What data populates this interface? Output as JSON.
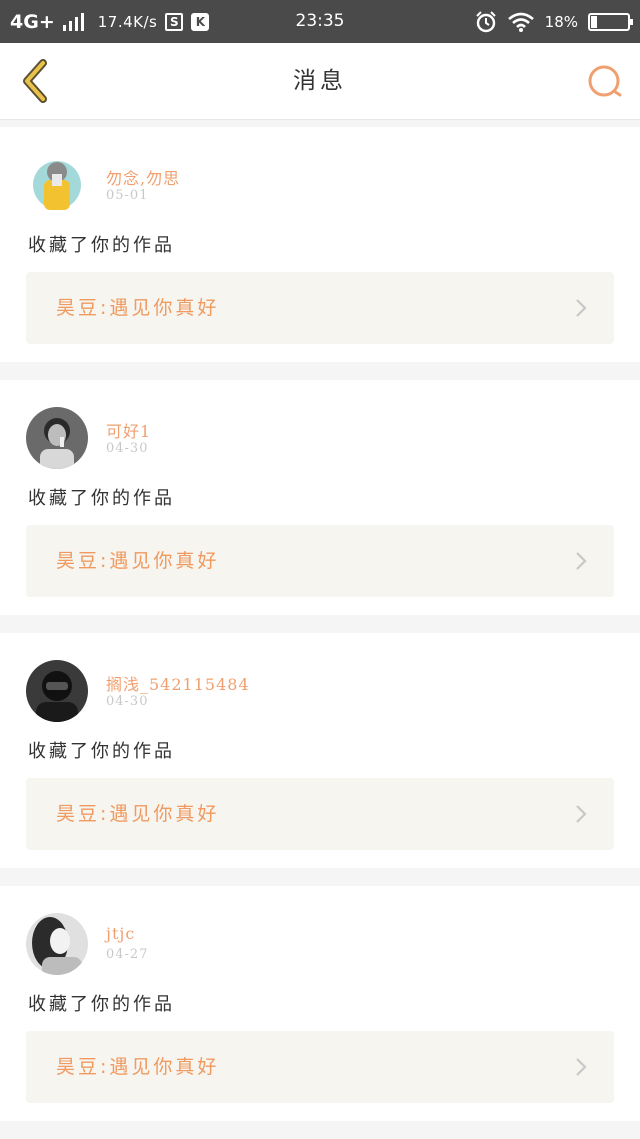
{
  "status_bar": {
    "network": "4G+",
    "speed": "17.4K/s",
    "s_icon": "S",
    "k_icon": "K",
    "time": "23:35",
    "battery_text": "18%",
    "battery_level": 0.18
  },
  "header": {
    "title": "消息",
    "back_icon": "chevron-left-icon",
    "search_icon": "search-icon",
    "accent_color": "#f0a070"
  },
  "messages": [
    {
      "username": "勿念,勿思",
      "date": "05-01",
      "action": "收藏了你的作品",
      "work_title": "昊豆:遇见你真好"
    },
    {
      "username": "可好1",
      "date": "04-30",
      "action": "收藏了你的作品",
      "work_title": "昊豆:遇见你真好"
    },
    {
      "username": "搁浅_542115484",
      "date": "04-30",
      "action": "收藏了你的作品",
      "work_title": "昊豆:遇见你真好"
    },
    {
      "username": "jtjc",
      "date": "04-27",
      "action": "收藏了你的作品",
      "work_title": "昊豆:遇见你真好"
    }
  ]
}
